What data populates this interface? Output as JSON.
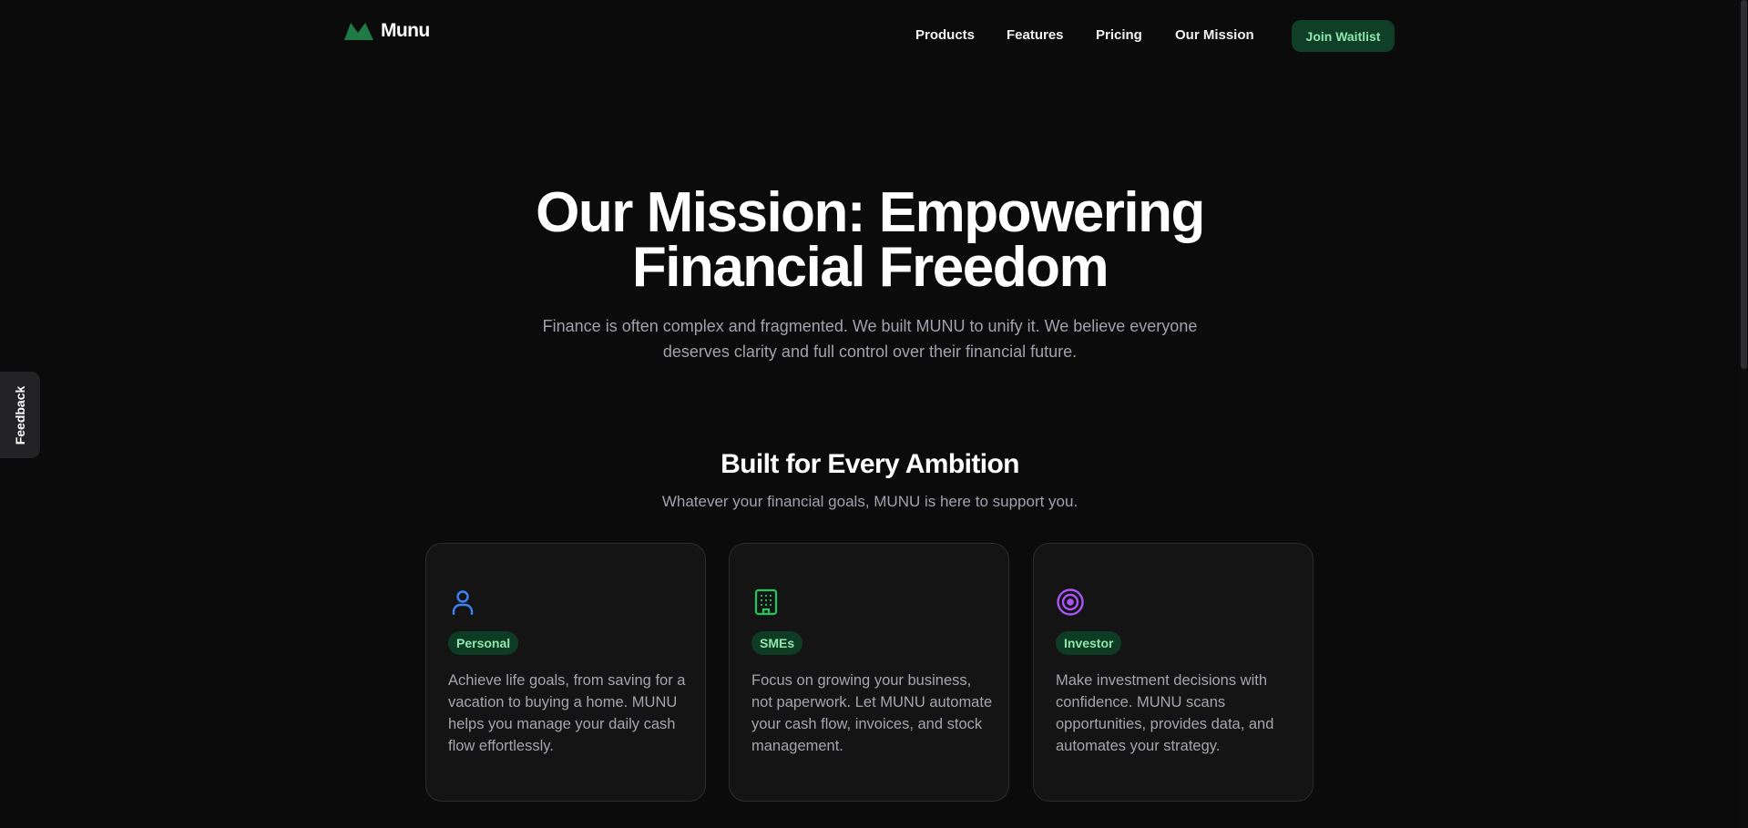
{
  "brand": {
    "name": "Munu",
    "color": "#1f7a45"
  },
  "nav": {
    "links": [
      {
        "label": "Products"
      },
      {
        "label": "Features"
      },
      {
        "label": "Pricing"
      },
      {
        "label": "Our Mission"
      }
    ],
    "cta_label": "Join Waitlist"
  },
  "hero": {
    "title_line1": "Our Mission: Empowering",
    "title_line2": "Financial Freedom",
    "subtitle_line1": "Finance is often complex and fragmented. We built MUNU to unify it. We believe everyone",
    "subtitle_line2": "deserves clarity and full control over their financial future."
  },
  "feedback": {
    "label": "Feedback"
  },
  "section": {
    "title": "Built for Every Ambition",
    "subtitle": "Whatever your financial goals, MUNU is here to support you."
  },
  "cards": [
    {
      "icon": "user-icon",
      "icon_color": "#3b82f6",
      "badge": "Personal",
      "text": "Achieve life goals, from saving for a vacation to buying a home. MUNU helps you manage your daily cash flow effortlessly."
    },
    {
      "icon": "building-icon",
      "icon_color": "#22c55e",
      "badge": "SMEs",
      "text": "Focus on growing your business, not paperwork. Let MUNU automate your cash flow, invoices, and stock management."
    },
    {
      "icon": "target-icon",
      "icon_color": "#a855f7",
      "badge": "Investor",
      "text": "Make investment decisions with confidence. MUNU scans opportunities, provides data, and automates your strategy."
    }
  ]
}
